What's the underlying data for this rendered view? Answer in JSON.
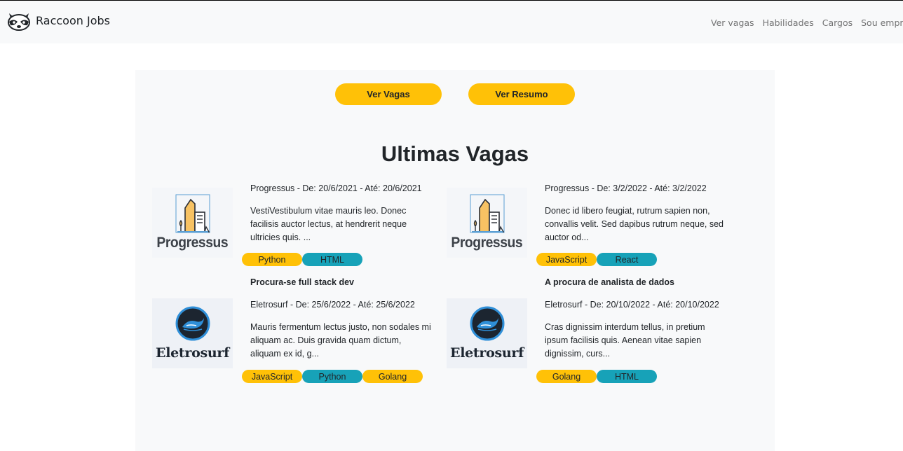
{
  "navbar": {
    "brand_icon": "raccoon-icon",
    "brand": "Raccoon Jobs",
    "links": [
      "Ver vagas",
      "Habilidades",
      "Cargos",
      "Sou empresa"
    ]
  },
  "actions": {
    "ver_vagas": "Ver Vagas",
    "ver_resumo": "Ver Resumo"
  },
  "section": {
    "title": "Ultimas Vagas"
  },
  "jobs": [
    {
      "title": "",
      "company_logo": "Progressus",
      "meta": "Progressus - De: 20/6/2021 - Até: 20/6/2021",
      "description": "VestiVestibulum vitae mauris leo. Donec facilisis auctor lectus, at hendrerit neque ultricies quis. ...",
      "tags": [
        "Python",
        "HTML"
      ]
    },
    {
      "title": "",
      "company_logo": "Progressus",
      "meta": "Progressus - De: 3/2/2022 - Até: 3/2/2022",
      "description": "Donec id libero feugiat, rutrum sapien non, convallis velit. Sed dapibus rutrum neque, sed auctor od...",
      "tags": [
        "JavaScript",
        "React"
      ]
    },
    {
      "title": "Procura-se full stack dev",
      "company_logo": "Eletrosurf",
      "meta": "Eletrosurf - De: 25/6/2022 - Até: 25/6/2022",
      "description": "Mauris fermentum lectus justo, non sodales mi aliquam ac. Duis gravida quam dictum, aliquam ex id, g...",
      "tags": [
        "JavaScript",
        "Python",
        "Golang"
      ]
    },
    {
      "title": "A procura de analista de dados",
      "company_logo": "Eletrosurf",
      "meta": "Eletrosurf - De: 20/10/2022 - Até: 20/10/2022",
      "description": "Cras dignissim interdum tellus, in pretium ipsum facilisis quis. Aenean vitae sapien dignissim, curs...",
      "tags": [
        "Golang",
        "HTML"
      ]
    }
  ],
  "colors": {
    "accent_yellow": "#ffc107",
    "accent_teal": "#17a2b8",
    "panel_bg": "#f8f9fa"
  }
}
